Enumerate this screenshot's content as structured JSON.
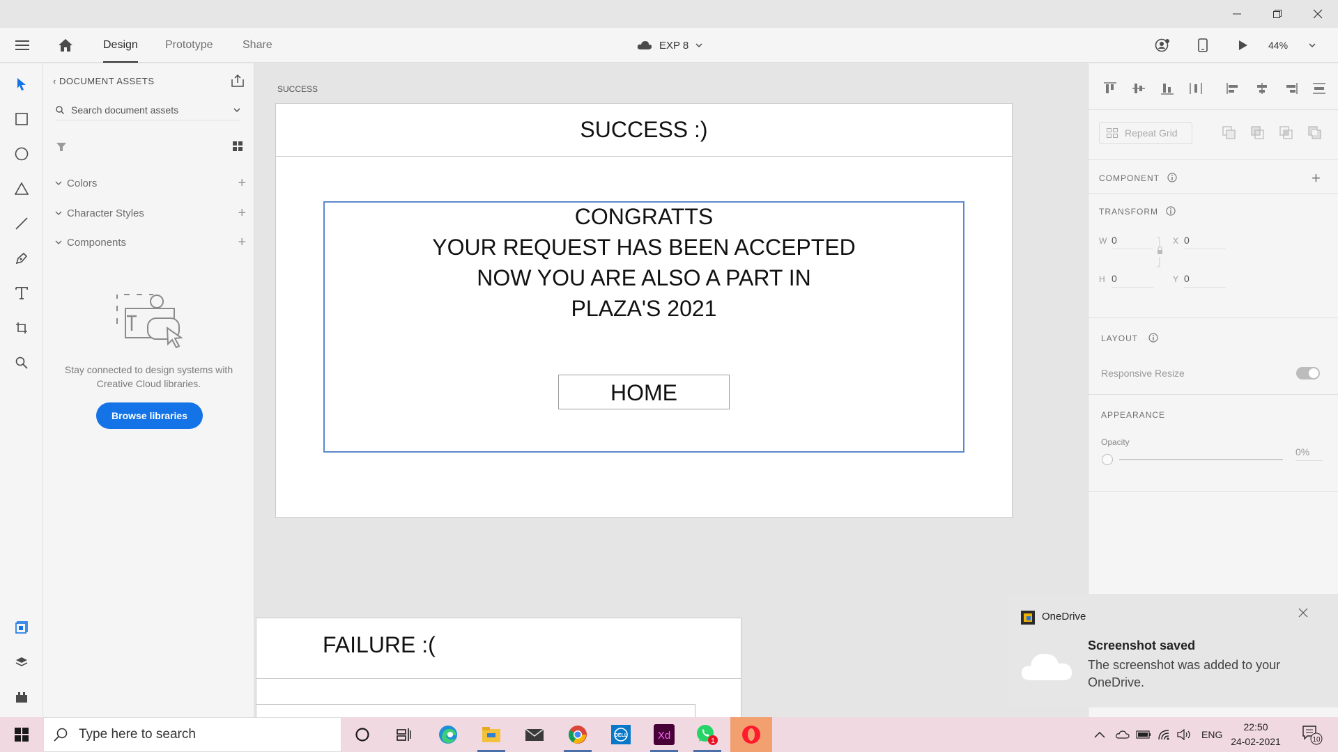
{
  "window": {
    "controls": [
      "minimize",
      "restore",
      "close"
    ]
  },
  "header": {
    "tabs": [
      {
        "label": "Design",
        "active": true
      },
      {
        "label": "Prototype",
        "active": false
      },
      {
        "label": "Share",
        "active": false
      }
    ],
    "document_title": "EXP 8",
    "zoom": "44%"
  },
  "tools": [
    "select-icon",
    "rectangle-icon",
    "ellipse-icon",
    "polygon-icon",
    "line-icon",
    "pen-icon",
    "text-icon",
    "artboard-icon",
    "zoom-icon",
    "assets-icon",
    "layers-icon",
    "plugins-icon"
  ],
  "assets": {
    "title": "DOCUMENT ASSETS",
    "search_placeholder": "Search document assets",
    "sections": [
      {
        "label": "Colors"
      },
      {
        "label": "Character Styles"
      },
      {
        "label": "Components"
      }
    ],
    "empty_message": "Stay connected to design systems with Creative Cloud libraries.",
    "browse_label": "Browse libraries"
  },
  "canvas": {
    "artboard_label": "SUCCESS",
    "header_title": "SUCCESS :)",
    "message_lines": [
      "CONGRATTS",
      "YOUR REQUEST HAS BEEN ACCEPTED",
      "NOW YOU ARE ALSO A PART IN",
      "PLAZA'S 2021"
    ],
    "home_button": "HOME",
    "failure_title": "FAILURE :("
  },
  "properties": {
    "repeat_grid": "Repeat Grid",
    "component_label": "COMPONENT",
    "transform_label": "TRANSFORM",
    "w_label": "W",
    "w_value": "0",
    "h_label": "H",
    "h_value": "0",
    "x_label": "X",
    "x_value": "0",
    "y_label": "Y",
    "y_value": "0",
    "layout_label": "LAYOUT",
    "responsive_resize": "Responsive Resize",
    "responsive_resize_on": true,
    "appearance_label": "APPEARANCE",
    "opacity_label": "Opacity",
    "opacity_value": "0%"
  },
  "notification": {
    "app": "OneDrive",
    "title": "Screenshot saved",
    "body": "The screenshot was added to your OneDrive."
  },
  "taskbar": {
    "search_placeholder": "Type here to search",
    "apps": [
      "cortana-icon",
      "task-view-icon",
      "edge-icon",
      "file-explorer-icon",
      "mail-icon",
      "chrome-icon",
      "dell-icon",
      "adobe-xd-icon",
      "whatsapp-icon",
      "opera-icon"
    ],
    "whatsapp_badge": "1",
    "language": "ENG",
    "time": "22:50",
    "date": "24-02-2021",
    "notification_count": "10"
  },
  "colors": {
    "accent": "#1473e6",
    "selection_border": "#5b88c9",
    "taskbar": "#f1d9e2"
  }
}
